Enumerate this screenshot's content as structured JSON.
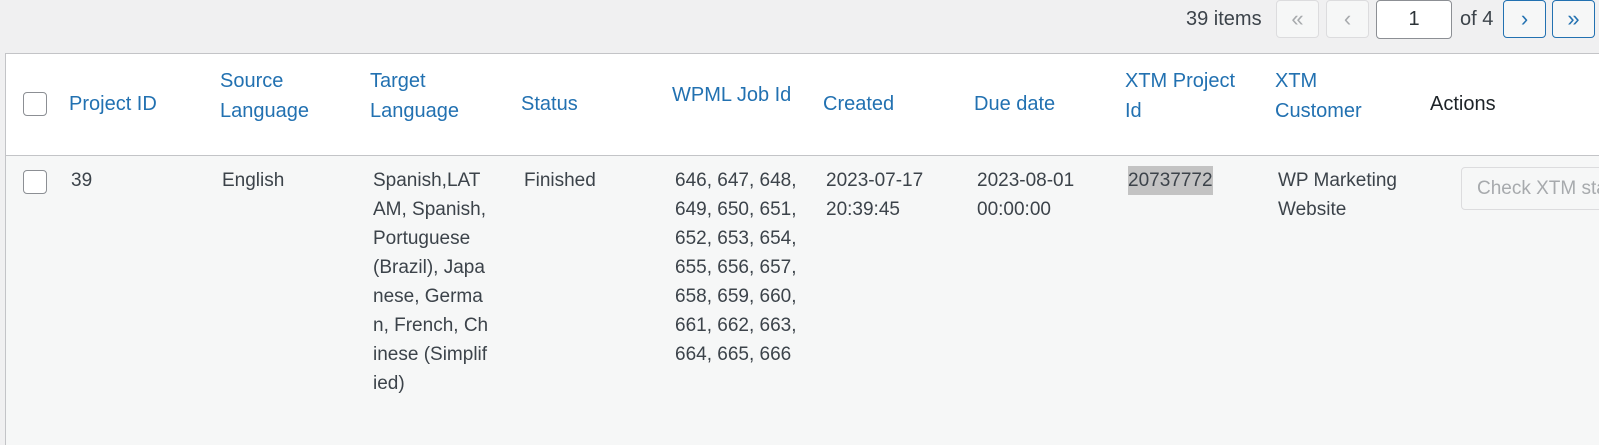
{
  "pagination": {
    "items_count": "39 items",
    "first_label": "«",
    "prev_label": "‹",
    "current_page": "1",
    "of_label": "of 4",
    "next_label": "›",
    "last_label": "»"
  },
  "table": {
    "columns": [
      "Project ID",
      "Source Language",
      "Target Language",
      "Status",
      "WPML Job Id",
      "Created",
      "Due date",
      "XTM Project Id",
      "XTM Customer",
      "Actions"
    ],
    "rows": [
      {
        "project_id": "39",
        "source_language": "English",
        "target_language": "Spanish,LATAM, Spanish, Portuguese (Brazil), Japanese, German, French, Chinese (Simplified)",
        "status": "Finished",
        "wpml_job_id": "646, 647, 648, 649, 650, 651, 652, 653, 654, 655, 656, 657, 658, 659, 660, 661, 662, 663, 664, 665, 666",
        "created": "2023-07-17 20:39:45",
        "due_date": "2023-08-01 00:00:00",
        "xtm_project_id": "20737772",
        "xtm_customer": "WP Marketing Website",
        "action_label": "Check XTM status"
      }
    ]
  },
  "colors": {
    "link": "#2271b1",
    "text": "#3c434a",
    "border": "#c3c4c7",
    "disabled": "#a7aaad"
  }
}
